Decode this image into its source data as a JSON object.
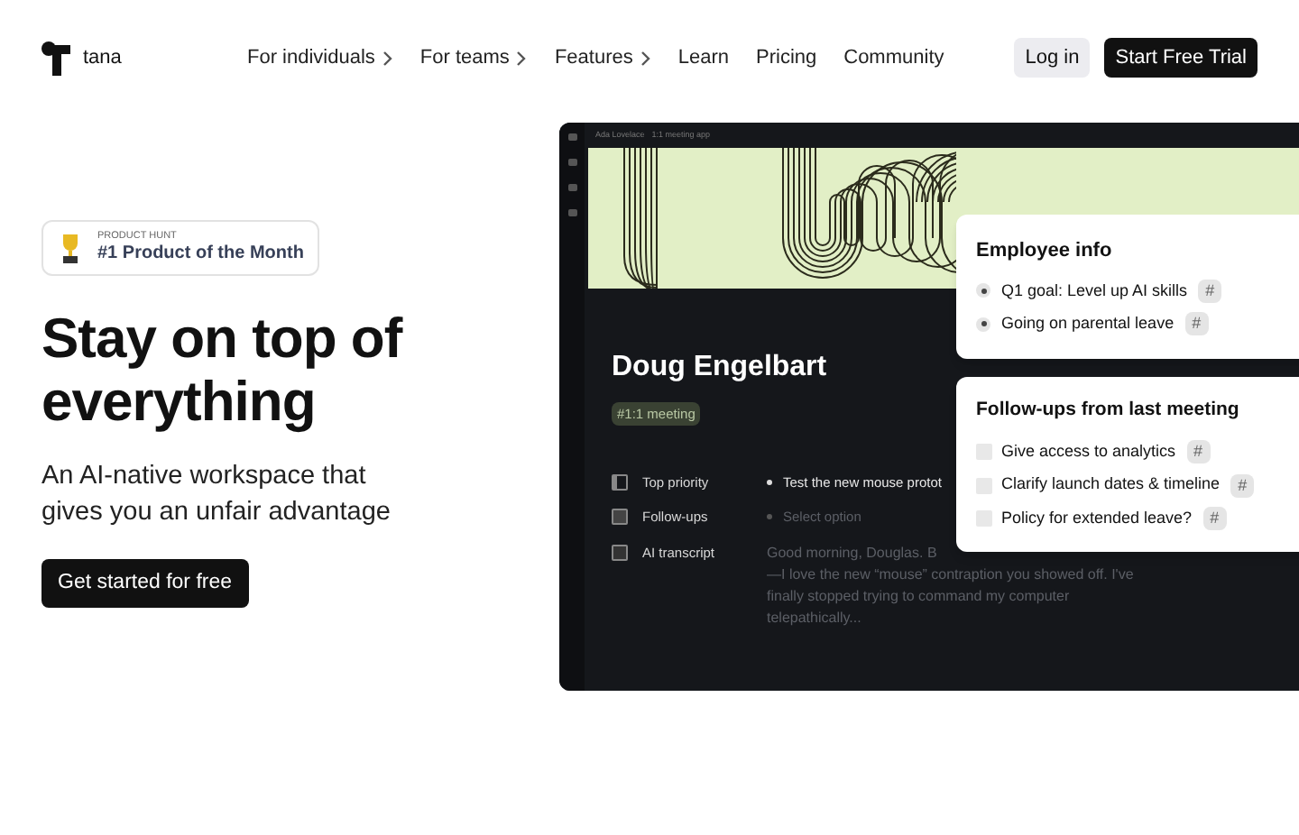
{
  "nav": {
    "brand": "tana",
    "links": [
      {
        "label": "For individuals",
        "has_menu": true
      },
      {
        "label": "For teams",
        "has_menu": true
      },
      {
        "label": "Features",
        "has_menu": true
      },
      {
        "label": "Learn",
        "has_menu": false
      },
      {
        "label": "Pricing",
        "has_menu": false
      },
      {
        "label": "Community",
        "has_menu": false
      }
    ],
    "login": "Log in",
    "cta": "Start Free Trial"
  },
  "hero": {
    "badge": {
      "eyebrow": "PRODUCT HUNT",
      "title": "#1 Product of the Month"
    },
    "heading": "Stay on top of everything",
    "subheading": "An AI-native workspace that gives you an unfair advantage",
    "cta": "Get started for free"
  },
  "app": {
    "breadcrumb": [
      "Ada Lovelace",
      "1:1 meeting app"
    ],
    "title": "Doug Engelbart",
    "tag": "#1:1 meeting",
    "fields": [
      {
        "label": "Top priority",
        "kind": "bullet",
        "lines": [
          "Test the new mouse protot"
        ]
      },
      {
        "label": "Follow-ups",
        "kind": "select",
        "lines": [
          "Select option"
        ]
      },
      {
        "label": "AI transcript",
        "kind": "text",
        "lines": [
          "Good morning, Douglas. B",
          "—I love the new “mouse” contraption you showed off. I've",
          "finally stopped trying to command my computer",
          "telepathically..."
        ]
      }
    ]
  },
  "employee_info": {
    "title": "Employee info",
    "items": [
      {
        "text": "Q1 goal: Level up AI skills",
        "tag": "#"
      },
      {
        "text": "Going on parental leave",
        "tag": "#"
      }
    ]
  },
  "followups": {
    "title": "Follow-ups from last meeting",
    "items": [
      {
        "text": "Give access to analytics",
        "checked": false,
        "tag": "#"
      },
      {
        "text": "Clarify launch dates & timeline",
        "checked": false,
        "tag": "#"
      },
      {
        "text": "Policy for extended leave?",
        "checked": false,
        "tag": "#"
      }
    ]
  }
}
